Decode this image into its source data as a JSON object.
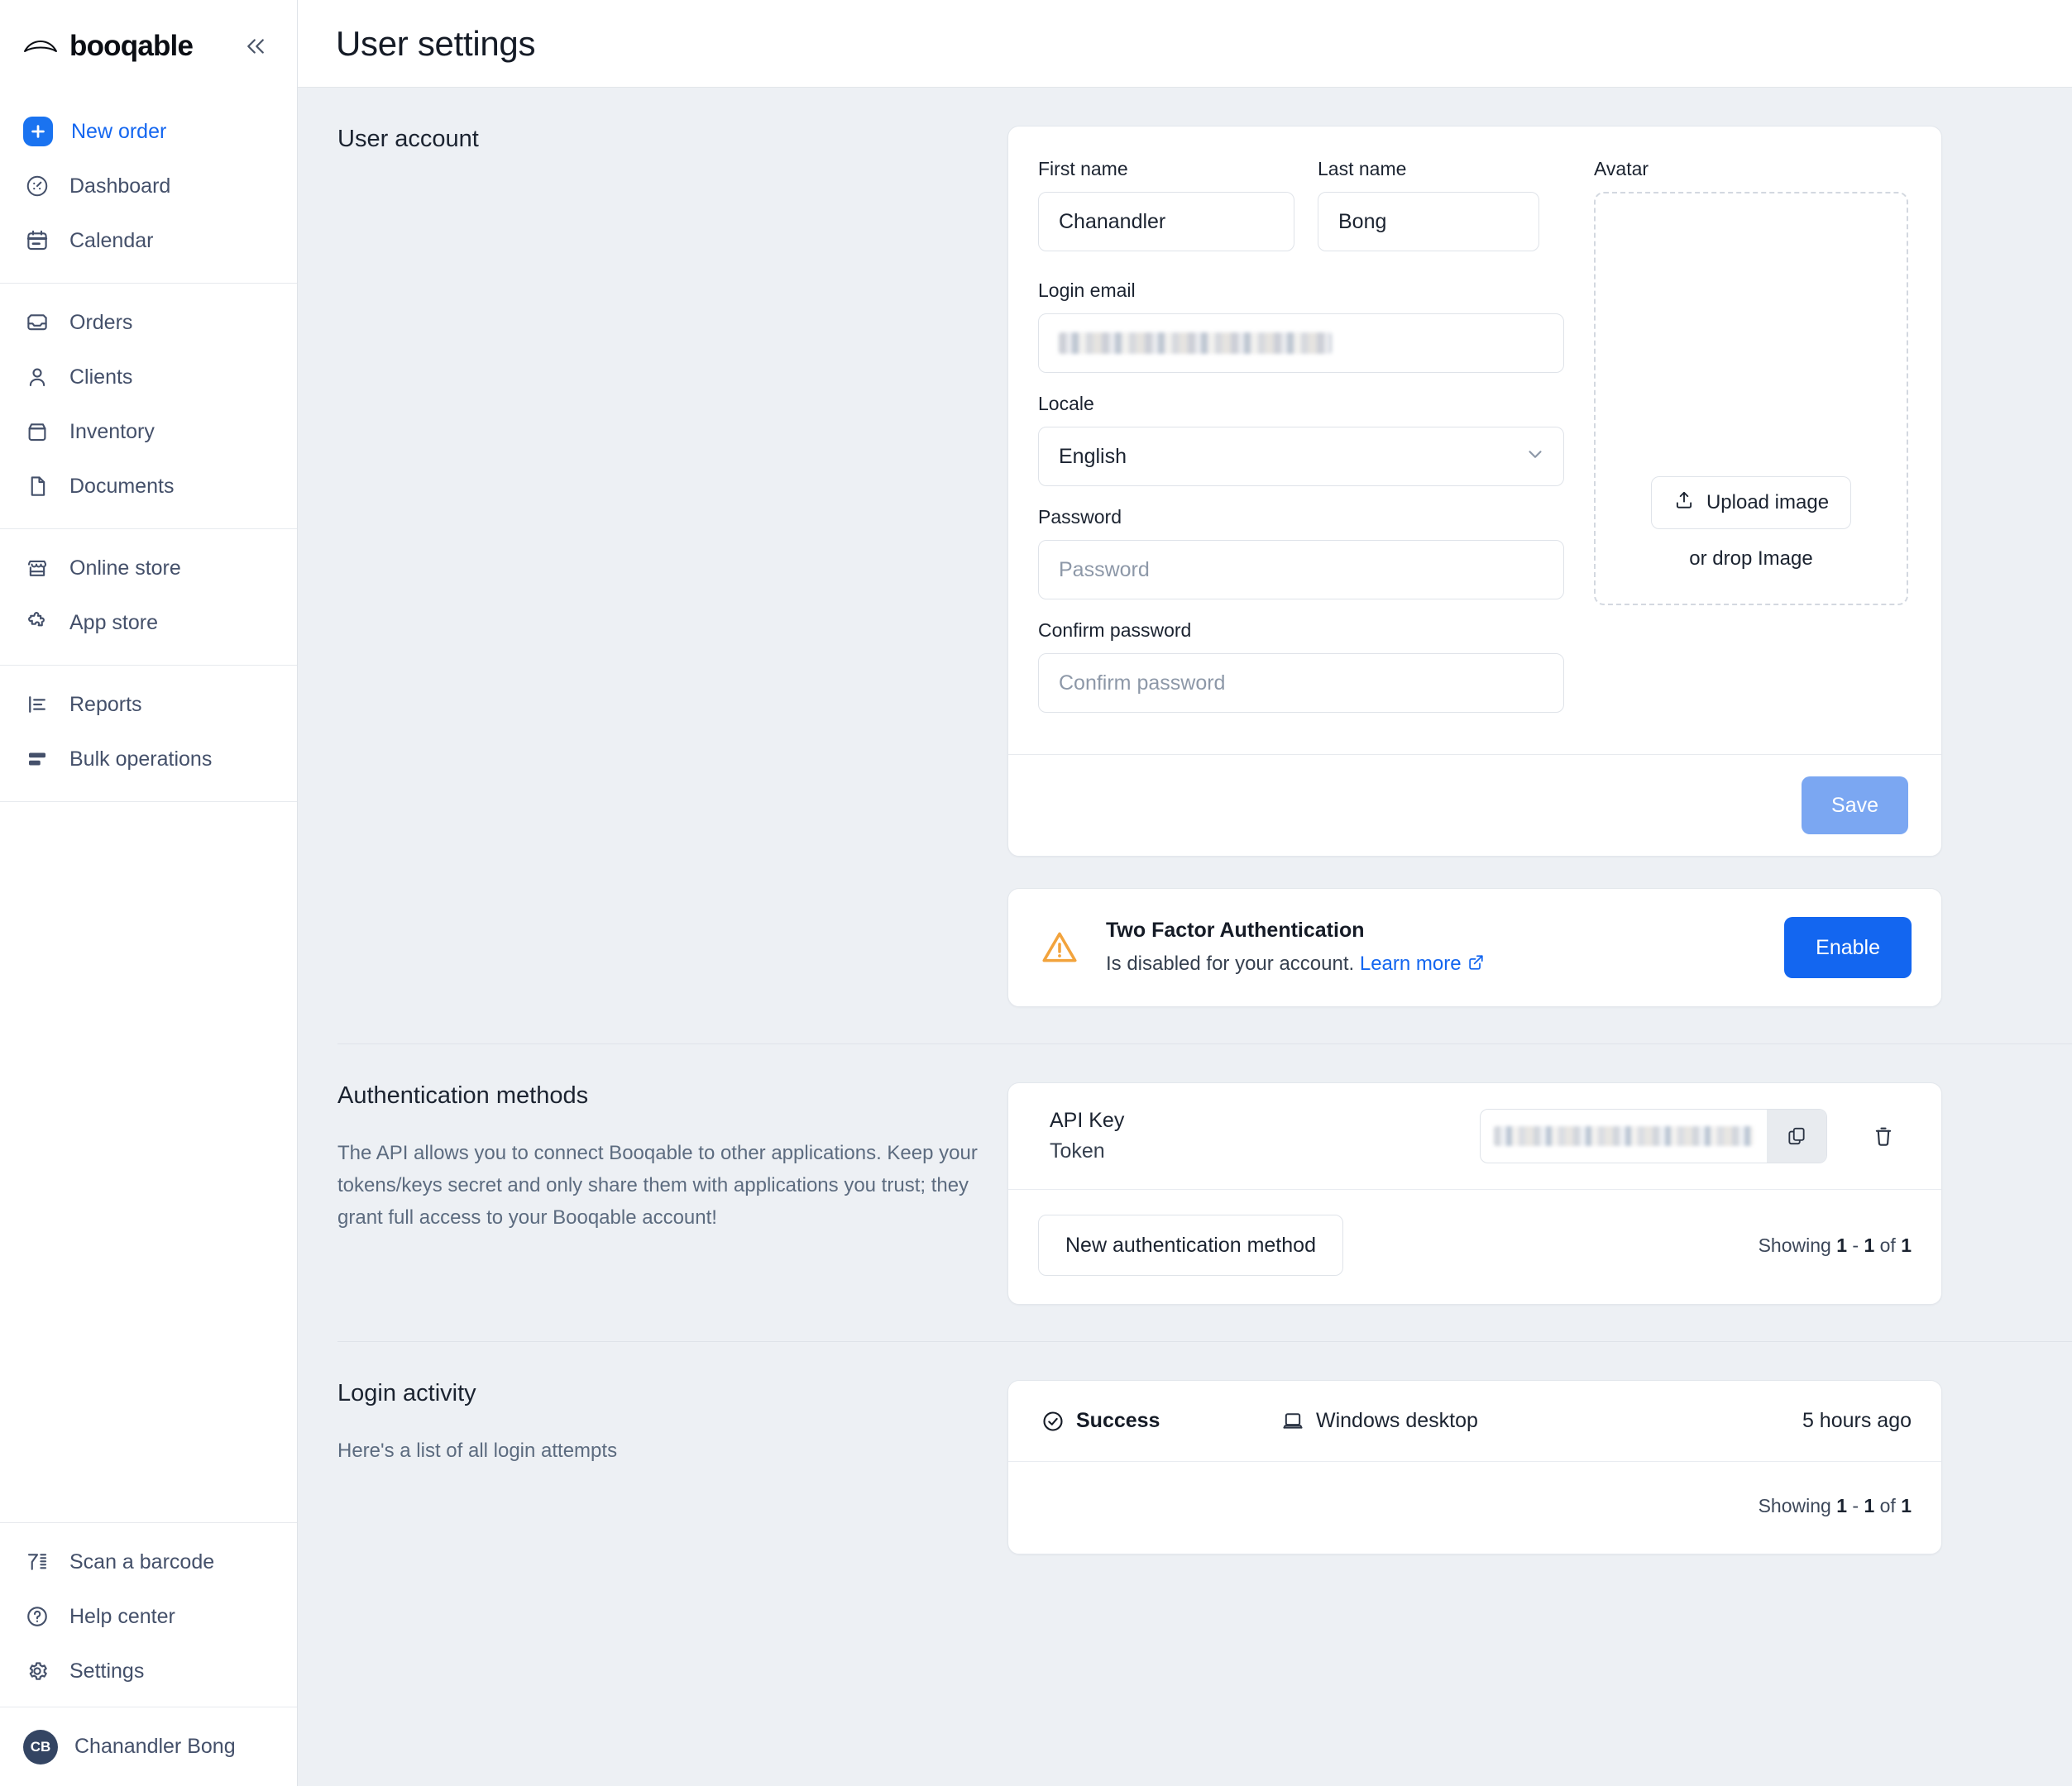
{
  "brand": {
    "name": "booqable"
  },
  "sidebar": {
    "groups": [
      {
        "items": [
          {
            "label": "New order",
            "icon": "plus-icon",
            "primary": true
          },
          {
            "label": "Dashboard",
            "icon": "dashboard-icon"
          },
          {
            "label": "Calendar",
            "icon": "calendar-icon"
          }
        ]
      },
      {
        "items": [
          {
            "label": "Orders",
            "icon": "orders-inbox-icon"
          },
          {
            "label": "Clients",
            "icon": "person-icon"
          },
          {
            "label": "Inventory",
            "icon": "box-icon"
          },
          {
            "label": "Documents",
            "icon": "document-icon"
          }
        ]
      },
      {
        "items": [
          {
            "label": "Online store",
            "icon": "storefront-icon"
          },
          {
            "label": "App store",
            "icon": "puzzle-icon"
          }
        ]
      },
      {
        "items": [
          {
            "label": "Reports",
            "icon": "report-bars-icon"
          },
          {
            "label": "Bulk operations",
            "icon": "bulk-rows-icon"
          }
        ]
      }
    ],
    "bottom_items": [
      {
        "label": "Scan a barcode",
        "icon": "barcode-scanner-icon"
      },
      {
        "label": "Help center",
        "icon": "question-circle-icon"
      },
      {
        "label": "Settings",
        "icon": "gear-icon"
      }
    ],
    "user": {
      "name": "Chanandler Bong",
      "initials": "CB"
    }
  },
  "header": {
    "title": "User settings"
  },
  "user_account": {
    "section_title": "User account",
    "first_name": {
      "label": "First name",
      "value": "Chanandler"
    },
    "last_name": {
      "label": "Last name",
      "value": "Bong"
    },
    "login_email": {
      "label": "Login email",
      "value": ""
    },
    "locale": {
      "label": "Locale",
      "value": "English"
    },
    "password": {
      "label": "Password",
      "placeholder": "Password",
      "value": ""
    },
    "confirm_password": {
      "label": "Confirm password",
      "placeholder": "Confirm password",
      "value": ""
    },
    "avatar": {
      "label": "Avatar",
      "upload_label": "Upload image",
      "drop_hint": "or drop Image"
    },
    "save_label": "Save"
  },
  "two_factor": {
    "title": "Two Factor Authentication",
    "description": "Is disabled for your account.",
    "link_label": "Learn more",
    "button_label": "Enable"
  },
  "auth_methods": {
    "section_title": "Authentication methods",
    "description": "The API allows you to connect Booqable to other applications. Keep your tokens/keys secret and only share them with applications you trust; they grant full access to your Booqable account!",
    "rows": [
      {
        "name": "API Key",
        "type": "Token",
        "key_value": ""
      }
    ],
    "new_method_label": "New authentication method",
    "showing": {
      "prefix": "Showing ",
      "from": "1",
      "dash": " - ",
      "to": "1",
      "of": " of ",
      "total": "1"
    }
  },
  "login_activity": {
    "section_title": "Login activity",
    "description": "Here's a list of all login attempts",
    "rows": [
      {
        "status": "Success",
        "device": "Windows desktop",
        "time": "5 hours ago"
      }
    ],
    "showing": {
      "prefix": "Showing ",
      "from": "1",
      "dash": " - ",
      "to": "1",
      "of": " of ",
      "total": "1"
    }
  },
  "colors": {
    "accent_blue": "#1366f0",
    "save_disabled": "#7ba7f2",
    "warning": "#f2a33c",
    "success": "#33b86b",
    "page_bg": "#edf0f4"
  }
}
